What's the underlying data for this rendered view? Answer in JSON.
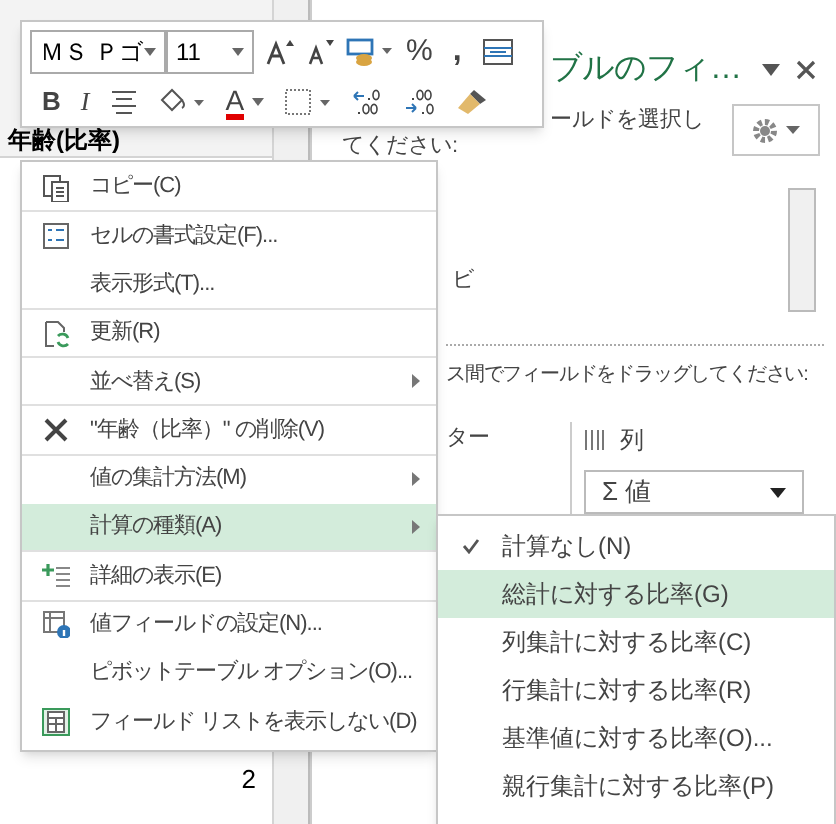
{
  "sheet": {
    "header_cell": "年齢(比率)",
    "values": [
      "2"
    ]
  },
  "field_pane": {
    "title": "ブルのフィ…",
    "instruction_1": "ールドを選択し",
    "instruction_2": "てください:",
    "list_item": "ビ",
    "drag_instruction": "ス間でフィールドをドラッグしてください:",
    "filter_label": "ター",
    "columns_label": "列",
    "value_chip": "Σ 値"
  },
  "mini_toolbar": {
    "font": "ＭＳ Ｐゴ",
    "size": "11",
    "percent": "%",
    "comma": ",",
    "bold": "B",
    "italic": "I",
    "font_color": "A"
  },
  "context_menu": [
    {
      "label": "コピー(C)",
      "kind": "copy",
      "submenu": false,
      "selected": false,
      "separator_after": true
    },
    {
      "label": "セルの書式設定(F)...",
      "kind": "format",
      "submenu": false,
      "selected": false,
      "separator_after": false
    },
    {
      "label": "表示形式(T)...",
      "kind": "plain",
      "submenu": false,
      "selected": false,
      "separator_after": true
    },
    {
      "label": "更新(R)",
      "kind": "refresh",
      "submenu": false,
      "selected": false,
      "separator_after": true
    },
    {
      "label": "並べ替え(S)",
      "kind": "plain",
      "submenu": true,
      "selected": false,
      "separator_after": true
    },
    {
      "label": "\"年齢（比率）\" の削除(V)",
      "kind": "delete",
      "submenu": false,
      "selected": false,
      "separator_after": true
    },
    {
      "label": "値の集計方法(M)",
      "kind": "plain",
      "submenu": true,
      "selected": false,
      "separator_after": false
    },
    {
      "label": "計算の種類(A)",
      "kind": "plain",
      "submenu": true,
      "selected": true,
      "separator_after": true
    },
    {
      "label": "詳細の表示(E)",
      "kind": "details",
      "submenu": false,
      "selected": false,
      "separator_after": true
    },
    {
      "label": "値フィールドの設定(N)...",
      "kind": "settings",
      "submenu": false,
      "selected": false,
      "separator_after": false
    },
    {
      "label": "ピボットテーブル オプション(O)...",
      "kind": "plain",
      "submenu": false,
      "selected": false,
      "separator_after": false
    },
    {
      "label": "フィールド リストを表示しない(D)",
      "kind": "fieldlist",
      "submenu": false,
      "selected": false,
      "separator_after": false
    }
  ],
  "submenu": [
    {
      "label": "計算なし(N)",
      "checked": true,
      "selected": false
    },
    {
      "label": "総計に対する比率(G)",
      "checked": false,
      "selected": true
    },
    {
      "label": "列集計に対する比率(C)",
      "checked": false,
      "selected": false
    },
    {
      "label": "行集計に対する比率(R)",
      "checked": false,
      "selected": false
    },
    {
      "label": "基準値に対する比率(O)...",
      "checked": false,
      "selected": false
    },
    {
      "label": "親行集計に対する比率(P)",
      "checked": false,
      "selected": false
    }
  ]
}
